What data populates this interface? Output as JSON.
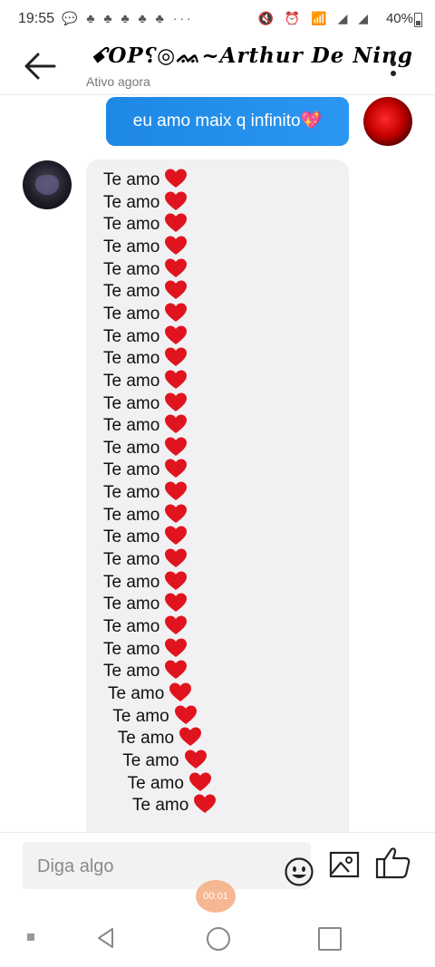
{
  "status_bar": {
    "time": "19:55",
    "notification_icons": "💬 ♣ ♣ ♣ ♣ ♣ ···",
    "system_icons": "🔇 ⏰ 📶 ◢ ◢",
    "battery": "40%"
  },
  "header": {
    "contact_name": "ꗃOP⸮◎ᨐ~Arthur De Ning",
    "status": "Ativo agora",
    "back_icon": "arrow-left-icon",
    "menu_icon": "more-vertical-icon"
  },
  "messages": {
    "outgoing": {
      "text": "eu amo maix q infinito💖"
    },
    "incoming": {
      "lines": [
        {
          "text": "Te amo"
        },
        {
          "text": "Te amo"
        },
        {
          "text": "Te amo"
        },
        {
          "text": "Te amo"
        },
        {
          "text": "Te amo"
        },
        {
          "text": "Te amo"
        },
        {
          "text": "Te amo"
        },
        {
          "text": "Te amo"
        },
        {
          "text": "Te amo"
        },
        {
          "text": "Te amo"
        },
        {
          "text": "Te amo"
        },
        {
          "text": "Te amo"
        },
        {
          "text": "Te amo"
        },
        {
          "text": "Te amo"
        },
        {
          "text": "Te amo"
        },
        {
          "text": "Te amo"
        },
        {
          "text": "Te amo"
        },
        {
          "text": "Te amo"
        },
        {
          "text": "Te amo"
        },
        {
          "text": "Te amo"
        },
        {
          "text": "Te amo"
        },
        {
          "text": "Te amo"
        },
        {
          "text": "Te amo"
        },
        {
          "text": "Te amo"
        },
        {
          "text": "Te amo"
        },
        {
          "text": "Te amo"
        },
        {
          "text": "Te amo"
        },
        {
          "text": "Te amo"
        },
        {
          "text": "Te amo"
        }
      ]
    }
  },
  "composer": {
    "placeholder": "Diga algo",
    "emoji_icon": "smiley-icon",
    "image_icon": "image-icon",
    "like_icon": "thumbs-up-icon"
  },
  "recording_timer": "00:01",
  "colors": {
    "outgoing_bubble": "#1e88e5",
    "incoming_bubble": "#f1f1f3",
    "heart": "#e0141e"
  }
}
